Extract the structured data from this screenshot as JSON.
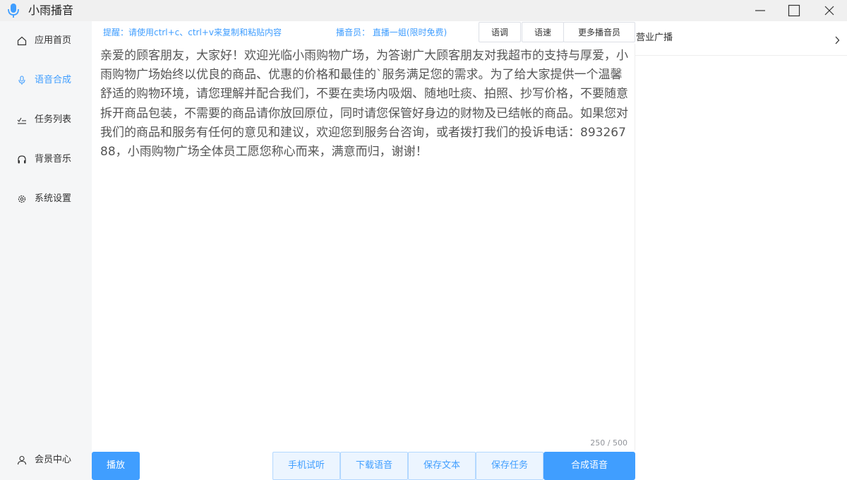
{
  "window": {
    "title": "小雨播音",
    "icons": {
      "app": "microphone-icon",
      "minimize": "minimize-icon",
      "maximize": "maximize-icon",
      "close": "close-icon"
    }
  },
  "sidebar": {
    "items": [
      {
        "label": "应用首页",
        "icon": "home-icon",
        "active": false
      },
      {
        "label": "语音合成",
        "icon": "microphone-icon",
        "active": true
      },
      {
        "label": "任务列表",
        "icon": "checklist-icon",
        "active": false
      },
      {
        "label": "背景音乐",
        "icon": "headphones-icon",
        "active": false
      },
      {
        "label": "系统设置",
        "icon": "gear-icon",
        "active": false
      }
    ],
    "footer": {
      "label": "会员中心",
      "icon": "user-icon"
    }
  },
  "toolbar": {
    "hint": "提醒：请使用ctrl+c、ctrl+v来复制和粘贴内容",
    "speaker": "播音员：  直播一姐(限时免费)",
    "tone_label": "语调",
    "speed_label": "语速",
    "more_label": "更多播音员"
  },
  "editor": {
    "text": "亲爱的顾客朋友，大家好！欢迎光临小雨购物广场，为答谢广大顾客朋友对我超市的支持与厚爱，小雨购物广场始终以优良的商品、优惠的价格和最佳的`服务满足您的需求。为了给大家提供一个温馨舒适的购物环境，请您理解并配合我们，不要在卖场内吸烟、随地吐痰、拍照、抄写价格，不要随意拆开商品包装，不需要的商品请你放回原位，同时请您保管好身边的财物及已结帐的商品。如果您对我们的商品和服务有任何的意见和建议，欢迎您到服务台咨询，或者拨打我们的投诉电话：89326788，小雨购物广场全体员工愿您称心而来，满意而归，谢谢！",
    "counter": "250 / 500"
  },
  "actions": {
    "play": "播放",
    "phone_test": "手机试听",
    "download": "下载语音",
    "save_text": "保存文本",
    "save_task": "保存任务",
    "synthesize": "合成语音"
  },
  "right_panel": {
    "category": "营业广播"
  },
  "colors": {
    "accent": "#409eff",
    "sidebar_bg": "#f5f6f7",
    "titlebar_bg": "#f0f0f0"
  }
}
